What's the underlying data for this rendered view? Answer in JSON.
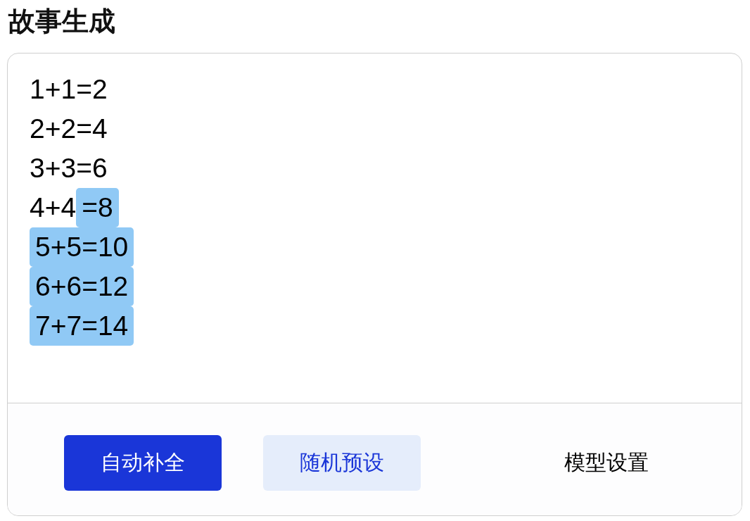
{
  "title": "故事生成",
  "editor": {
    "lines": [
      {
        "segments": [
          {
            "text": "1+1=2",
            "generated": false
          }
        ]
      },
      {
        "segments": [
          {
            "text": "2+2=4",
            "generated": false
          }
        ]
      },
      {
        "segments": [
          {
            "text": "3+3=6",
            "generated": false
          }
        ]
      },
      {
        "segments": [
          {
            "text": "4+4",
            "generated": false
          },
          {
            "text": "=8",
            "generated": true
          }
        ]
      },
      {
        "segments": [
          {
            "text": "5+5=10",
            "generated": true
          }
        ]
      },
      {
        "segments": [
          {
            "text": "6+6=12",
            "generated": true
          }
        ]
      },
      {
        "segments": [
          {
            "text": "7+7=14",
            "generated": true
          }
        ]
      }
    ]
  },
  "buttons": [
    {
      "label": "自动补全",
      "kind": "primary"
    },
    {
      "label": "随机预设",
      "kind": "secondary"
    },
    {
      "label": "模型设置",
      "kind": "text"
    }
  ]
}
